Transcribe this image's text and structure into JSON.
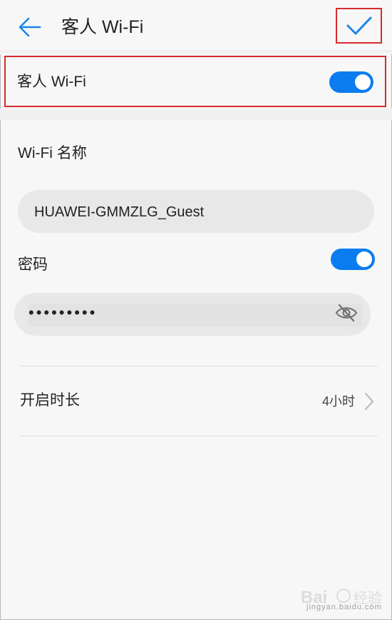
{
  "header": {
    "title": "客人 Wi-Fi",
    "back_icon": "arrow-left-icon",
    "confirm_icon": "checkmark-icon",
    "accent": "#1a86e8"
  },
  "guest_wifi": {
    "label": "客人 Wi-Fi",
    "enabled": true
  },
  "wifi_name": {
    "label": "Wi-Fi 名称",
    "value": "HUAWEI-GMMZLG_Guest"
  },
  "password": {
    "label": "密码",
    "enabled": true,
    "masked_value": "•••••••••",
    "visibility_icon": "eye-hidden-icon"
  },
  "duration": {
    "label": "开启时长",
    "value": "4小时",
    "chevron_icon": "chevron-right-icon"
  },
  "watermark": {
    "text": "jingyan.baidu.com"
  },
  "colors": {
    "toggle_on": "#0a7cf0",
    "highlight_border": "#d62b2b",
    "background": "#f7f7f7"
  }
}
